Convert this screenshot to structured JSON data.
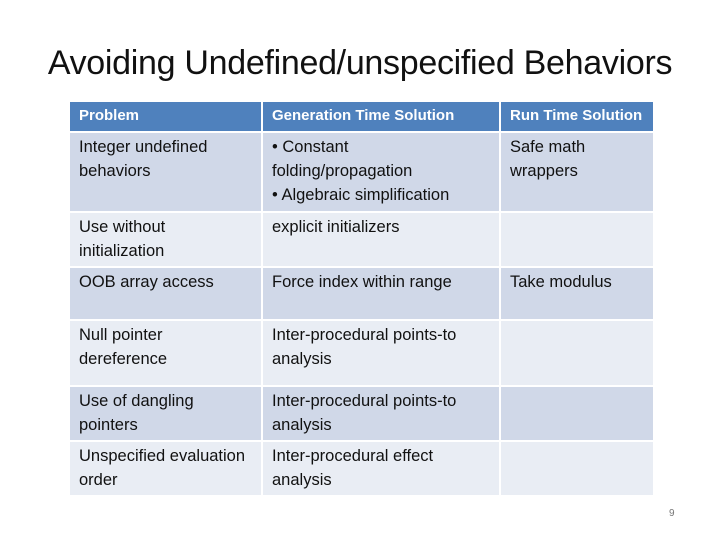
{
  "slide": {
    "title": "Avoiding Undefined/unspecified Behaviors",
    "page_number": "9"
  },
  "table": {
    "headers": [
      "Problem",
      "Generation Time Solution",
      "Run Time Solution"
    ],
    "rows": [
      {
        "problem": "Integer undefined behaviors",
        "generation": [
          "• Constant folding/propagation",
          "• Algebraic simplification"
        ],
        "runtime": "Safe math wrappers"
      },
      {
        "problem": "Use without initialization",
        "generation": [
          "explicit initializers"
        ],
        "runtime": ""
      },
      {
        "problem": "OOB array access",
        "generation": [
          "Force index within range"
        ],
        "runtime": "Take modulus"
      },
      {
        "problem": "Null pointer dereference",
        "generation": [
          "Inter-procedural points-to analysis"
        ],
        "runtime": ""
      },
      {
        "problem": "Use of dangling pointers",
        "generation": [
          "Inter-procedural points-to analysis"
        ],
        "runtime": ""
      },
      {
        "problem": "Unspecified evaluation order",
        "generation": [
          "Inter-procedural effect analysis"
        ],
        "runtime": ""
      }
    ]
  },
  "colors": {
    "header_bg": "#4f81bd",
    "row_odd_bg": "#d0d8e8",
    "row_even_bg": "#e9edf4"
  }
}
